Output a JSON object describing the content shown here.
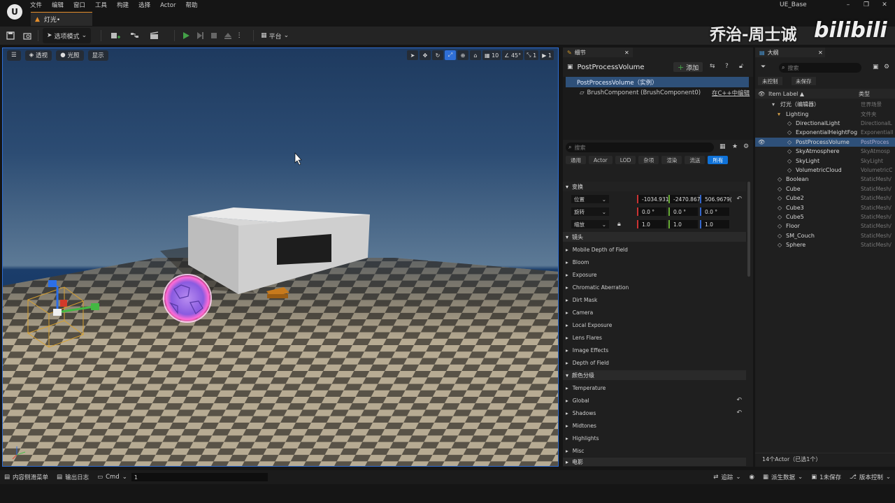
{
  "app": {
    "menu": [
      "文件",
      "编辑",
      "窗口",
      "工具",
      "构建",
      "选择",
      "Actor",
      "帮助"
    ],
    "level_tab": "灯光•",
    "project_name": "UE_Base",
    "window_controls": [
      "–",
      "❐",
      "✕"
    ]
  },
  "toolbar": {
    "mode_label": "选项模式",
    "platform_label": "平台"
  },
  "watermark": {
    "text": "乔治-周士诚",
    "logo": "bilibili"
  },
  "viewport": {
    "perspective_label": "透视",
    "lit_label": "光照",
    "show_label": "显示",
    "grid_snap": "10",
    "rot_snap": "45°",
    "scale_snap": "1",
    "cam_speed": "1"
  },
  "details": {
    "tab_label": "细节",
    "actor_title": "PostProcessVolume",
    "add_label": "添加",
    "components": [
      {
        "label": "PostProcessVolume（实例）",
        "selected": true
      },
      {
        "label": "BrushComponent (BrushComponent0)",
        "action": "在C++中编辑"
      }
    ],
    "search_placeholder": "搜索",
    "filters": [
      "通用",
      "Actor",
      "LOD",
      "杂项",
      "渲染",
      "流送",
      "所有"
    ],
    "transform_section": "变换",
    "transform": {
      "location": {
        "label": "位置",
        "x": "-1034.931",
        "y": "-2470.867",
        "z": "506.9679("
      },
      "rotation": {
        "label": "旋转",
        "x": "0.0 °",
        "y": "0.0 °",
        "z": "0.0 °"
      },
      "scale": {
        "label": "缩放",
        "x": "1.0",
        "y": "1.0",
        "z": "1.0"
      }
    },
    "lens_section": "镜头",
    "lens_items": [
      "Mobile Depth of Field",
      "Bloom",
      "Exposure",
      "Chromatic Aberration",
      "Dirt Mask",
      "Camera",
      "Local Exposure",
      "Lens Flares",
      "Image Effects",
      "Depth of Field"
    ],
    "color_grading_section": "颜色分级",
    "color_grading_items": [
      "Temperature",
      "Global",
      "Shadows",
      "Midtones",
      "Highlights",
      "Misc"
    ],
    "film_section": "电影"
  },
  "outliner": {
    "tab_label": "大纲",
    "search_placeholder": "搜索",
    "chip_unsaved_control": "未控制",
    "chip_unsaved": "未保存",
    "col_label": "Item Label ▲",
    "col_type": "类型",
    "rows": [
      {
        "label": "灯光（编辑器）",
        "type": "世界场景",
        "indent": 0
      },
      {
        "label": "Lighting",
        "type": "文件夹",
        "indent": 1
      },
      {
        "label": "DirectionalLight",
        "type": "DirectionalL",
        "indent": 2
      },
      {
        "label": "ExponentialHeightFog",
        "type": "Exponentiall",
        "indent": 2
      },
      {
        "label": "PostProcessVolume",
        "type": "PostProces",
        "indent": 2,
        "selected": true
      },
      {
        "label": "SkyAtmosphere",
        "type": "SkyAtmosp",
        "indent": 2
      },
      {
        "label": "SkyLight",
        "type": "SkyLight",
        "indent": 2
      },
      {
        "label": "VolumetricCloud",
        "type": "VolumetricC",
        "indent": 2
      },
      {
        "label": "Boolean",
        "type": "StaticMesh/",
        "indent": 1
      },
      {
        "label": "Cube",
        "type": "StaticMesh/",
        "indent": 1
      },
      {
        "label": "Cube2",
        "type": "StaticMesh/",
        "indent": 1
      },
      {
        "label": "Cube3",
        "type": "StaticMesh/",
        "indent": 1
      },
      {
        "label": "Cube5",
        "type": "StaticMesh/",
        "indent": 1
      },
      {
        "label": "Floor",
        "type": "StaticMesh/",
        "indent": 1
      },
      {
        "label": "SM_Couch",
        "type": "StaticMesh/",
        "indent": 1
      },
      {
        "label": "Sphere",
        "type": "StaticMesh/",
        "indent": 1
      }
    ],
    "footer": "14个Actor（已选1个）"
  },
  "statusbar": {
    "content_drawer": "内容侧滑菜单",
    "output_log": "输出日志",
    "cmd_label": "Cmd",
    "cmd_value": "1",
    "trace": "追踪",
    "derived_data": "派生数据",
    "unsaved": "1未保存",
    "source_control": "版本控制"
  },
  "colors": {
    "accent_blue": "#2f6fd6",
    "selection": "#2e5079",
    "play_green": "#43a047",
    "tab_orange": "#e58e2b"
  }
}
